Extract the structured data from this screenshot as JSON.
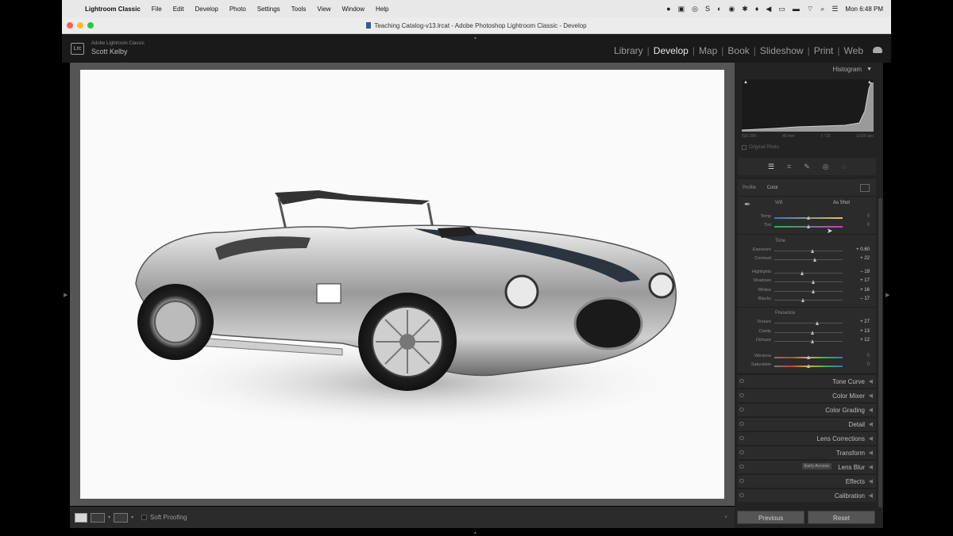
{
  "menubar": {
    "app": "Lightroom Classic",
    "items": [
      "File",
      "Edit",
      "Develop",
      "Photo",
      "Settings",
      "Tools",
      "View",
      "Window",
      "Help"
    ],
    "clock": "Mon 6:48 PM"
  },
  "window": {
    "title": "Teaching Catalog-v13.lrcat - Adobe Photoshop Lightroom Classic - Develop"
  },
  "identity": {
    "logo": "Lrc",
    "product": "Adobe Lightroom Classic",
    "user": "Scott Kelby"
  },
  "modules": {
    "library": "Library",
    "develop": "Develop",
    "map": "Map",
    "book": "Book",
    "slideshow": "Slideshow",
    "print": "Print",
    "web": "Web",
    "active": "Develop"
  },
  "histogram": {
    "title": "Histogram",
    "iso": "ISO 200",
    "focal": "45 mm",
    "aperture": "ƒ / 22",
    "shutter": "1/125 sec",
    "original_photo": "Original Photo"
  },
  "basic": {
    "profile_label": "Profile",
    "profile_value": "Color",
    "wb_label": "WB",
    "wb_value": "As Shot",
    "tone_label": "Tone",
    "presence_label": "Presence",
    "sliders": {
      "temp": {
        "label": "Temp",
        "value": "0",
        "pos": 0.5
      },
      "tint": {
        "label": "Tint",
        "value": "0",
        "pos": 0.5
      },
      "exposure": {
        "label": "Exposure",
        "value": "+ 0.60",
        "pos": 0.56
      },
      "contrast": {
        "label": "Contrast",
        "value": "+ 22",
        "pos": 0.6
      },
      "highlights": {
        "label": "Highlights",
        "value": "– 19",
        "pos": 0.41
      },
      "shadows": {
        "label": "Shadows",
        "value": "+ 17",
        "pos": 0.58
      },
      "whites": {
        "label": "Whites",
        "value": "+ 16",
        "pos": 0.58
      },
      "blacks": {
        "label": "Blacks",
        "value": "– 17",
        "pos": 0.42
      },
      "texture": {
        "label": "Texture",
        "value": "+ 27",
        "pos": 0.63
      },
      "clarity": {
        "label": "Clarity",
        "value": "+ 13",
        "pos": 0.56
      },
      "dehaze": {
        "label": "Dehaze",
        "value": "+ 12",
        "pos": 0.56
      },
      "vibrance": {
        "label": "Vibrance",
        "value": "0",
        "pos": 0.5
      },
      "saturation": {
        "label": "Saturation",
        "value": "0",
        "pos": 0.5
      }
    }
  },
  "panels": {
    "tone_curve": "Tone Curve",
    "color_mixer": "Color Mixer",
    "color_grading": "Color Grading",
    "detail": "Detail",
    "lens_corrections": "Lens Corrections",
    "transform": "Transform",
    "lens_blur": "Lens Blur",
    "lens_blur_badge": "Early Access",
    "effects": "Effects",
    "calibration": "Calibration"
  },
  "toolbar": {
    "soft_proofing": "Soft Proofing"
  },
  "bottom": {
    "previous": "Previous",
    "reset": "Reset"
  }
}
